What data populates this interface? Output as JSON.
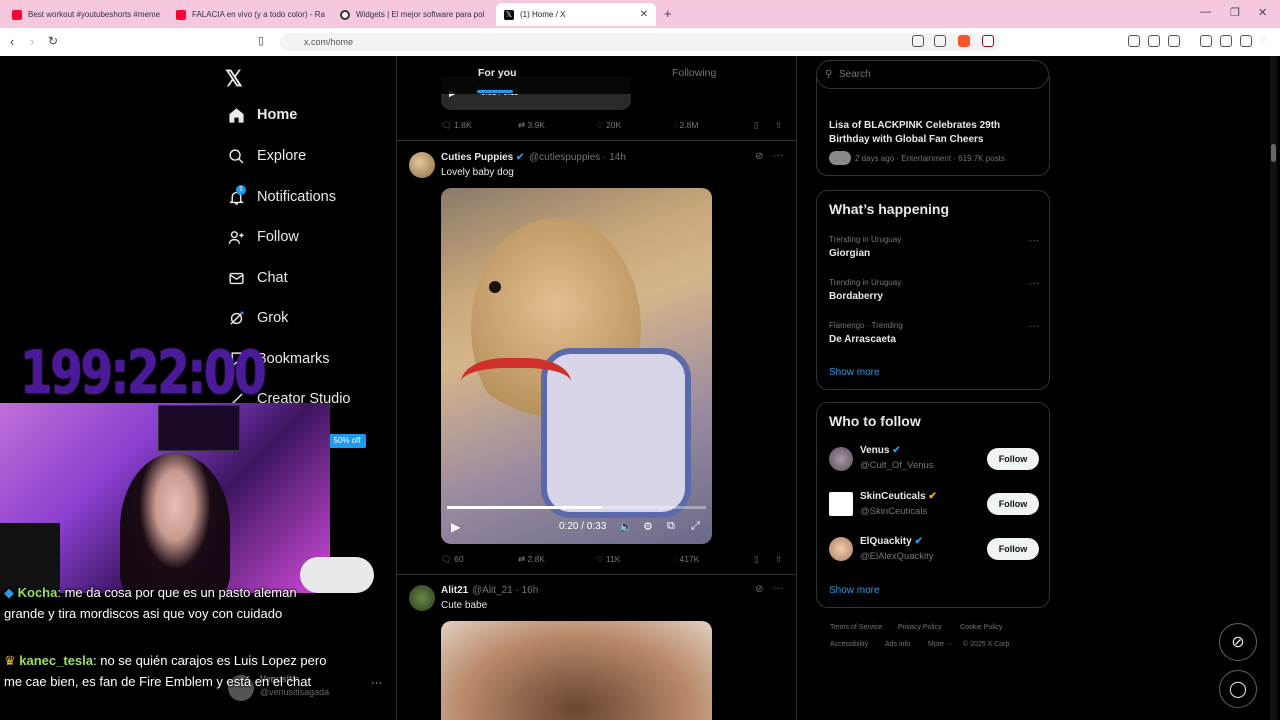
{
  "browser": {
    "tabs": [
      {
        "title": "Best workout #youtubeshorts #meme",
        "icon": "youtube-icon",
        "color": "#ff0033"
      },
      {
        "title": "FALACIA en vivo (y a todo color) - Ra",
        "icon": "youtube-icon",
        "color": "#ff0033"
      },
      {
        "title": "Widgets | El mejor software para pol",
        "icon": "widgets-icon",
        "color": "#333333"
      },
      {
        "title": "(1) Home / X",
        "icon": "x-icon",
        "color": "#000000"
      }
    ],
    "url": "x.com/home"
  },
  "nav": {
    "items": [
      {
        "label": "Home",
        "icon": "home-icon"
      },
      {
        "label": "Explore",
        "icon": "search-icon"
      },
      {
        "label": "Notifications",
        "icon": "bell-icon"
      },
      {
        "label": "Follow",
        "icon": "person-add-icon"
      },
      {
        "label": "Chat",
        "icon": "mail-icon"
      },
      {
        "label": "Grok",
        "icon": "grok-icon"
      },
      {
        "label": "Bookmarks",
        "icon": "bookmark-icon"
      },
      {
        "label": "Creator Studio",
        "icon": "creator-icon"
      }
    ],
    "notification_count": "1",
    "sale_badge": "50% off"
  },
  "timeline": {
    "tabs": [
      "For you",
      "Following"
    ],
    "top_post": {
      "player_time": "0:02 / 0:11",
      "stats": {
        "replies": "1.8K",
        "reposts": "3.9K",
        "likes": "20K",
        "views": "2.8M"
      }
    },
    "post1": {
      "name": "Cuties Puppies",
      "handle": "@cutiespuppies · 14h",
      "text": "Lovely baby dog",
      "player_time": "0:20 / 0:33",
      "progress": 0.6,
      "stats": {
        "replies": "60",
        "reposts": "2.8K",
        "likes": "11K",
        "views": "417K"
      }
    },
    "post2": {
      "name": "Alit21",
      "handle": "@Alit_21 · 16h",
      "text": "Cute babe"
    }
  },
  "right": {
    "search_placeholder": "Search",
    "top_trend": {
      "title": "Lisa of BLACKPINK Celebrates 29th Birthday with Global Fan Cheers",
      "meta": "2 days ago · Entertainment · 619.7K posts"
    },
    "happening": {
      "title": "What’s happening",
      "items": [
        {
          "context": "Trending in Uruguay",
          "name": "Giorgian"
        },
        {
          "context": "Trending in Uruguay",
          "name": "Bordaberry"
        },
        {
          "context": "Flamengo · Trending",
          "name": "De Arrascaeta"
        }
      ],
      "show_more": "Show more"
    },
    "who_to_follow": {
      "title": "Who to follow",
      "accounts": [
        {
          "name": "Venus",
          "handle": "@Cult_Of_Venus",
          "button": "Follow"
        },
        {
          "name": "SkinCeuticals",
          "handle": "@SkinCeuticals",
          "button": "Follow"
        },
        {
          "name": "ElQuackity",
          "handle": "@ElAlexQuackity",
          "button": "Follow"
        }
      ],
      "show_more": "Show more"
    },
    "footer": {
      "line1": [
        "Terms of Service",
        "Privacy Policy",
        "Cookie Policy"
      ],
      "line2": [
        "Accessibility",
        "Ads info",
        "More ···",
        "© 2025 X Corp."
      ]
    }
  },
  "overlay": {
    "timer": "199:22:00",
    "chat": [
      {
        "user": "Kocha",
        "msg": ": me da cosa por que es un pasto aleman grande y tira mordiscos asi que voy con cuidado"
      },
      {
        "user": "kanec_tesla",
        "msg": ": no se quién carajos es Luis Lopez pero me cae bien, es fan de Fire Emblem y está en el chat"
      }
    ],
    "account_name": "Venusitis",
    "account_handle": "@venusitisagada"
  }
}
